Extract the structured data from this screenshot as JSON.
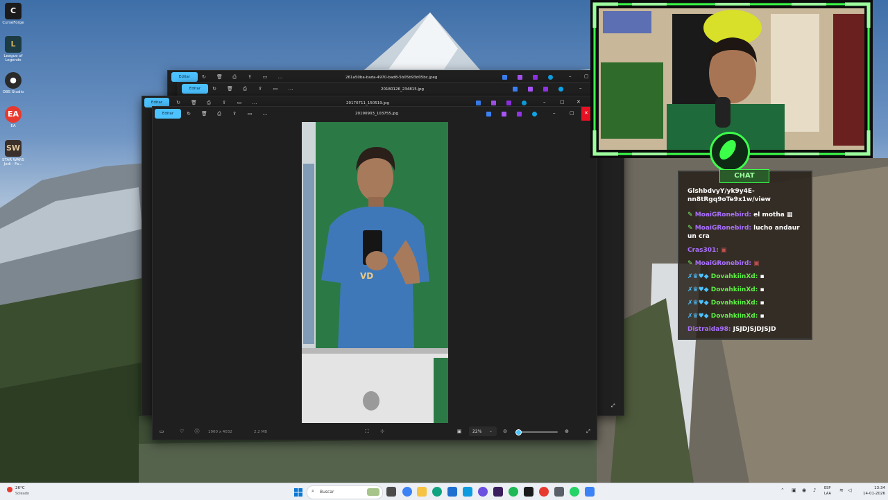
{
  "desktop": {
    "icons": [
      {
        "label": "CurseForge",
        "icon": "curseforge-icon",
        "color": "#1b1b1b"
      },
      {
        "label": "League of Legends",
        "icon": "league-of-legends-icon",
        "color": "#1c3b42"
      },
      {
        "label": "OBS Studio",
        "icon": "obs-icon",
        "color": "#2a2a2a"
      },
      {
        "label": "EA",
        "icon": "ea-icon",
        "color": "#e8392f"
      },
      {
        "label": "STAR WARS Jedi - Fa...",
        "icon": "star-wars-icon",
        "color": "#3a2f2a"
      }
    ]
  },
  "windows": [
    {
      "filename": "261a50ba-bada-4970-bad8-5b05b93d05bc.jpeg",
      "edit_label": "Editar"
    },
    {
      "filename": "20180126_234815.jpg",
      "edit_label": "Editar"
    },
    {
      "filename": "20170711_150519.jpg",
      "edit_label": "Editar"
    },
    {
      "filename": "20190903_103755.jpg",
      "edit_label": "Editar"
    }
  ],
  "viewer": {
    "resolution": "1960 x 4032",
    "size": "2.2 MB",
    "zoom": "22%",
    "zoom_slider_fraction": 0.05
  },
  "chat": {
    "header": "CHAT",
    "lines": [
      {
        "user": "",
        "text": "GlshbdvyY/yk9y4E-nn8tRgq9oTe9x1w/view",
        "user_color": "#ffffff"
      },
      {
        "user": "MoaiGRonebird:",
        "text": "el motha",
        "user_color": "#a970ff"
      },
      {
        "user": "MoaiGRonebird:",
        "text": "lucho andaur un cra",
        "user_color": "#a970ff"
      },
      {
        "user": "Cras301:",
        "text": "",
        "user_color": "#a970ff"
      },
      {
        "user": "MoaiGRonebird:",
        "text": "",
        "user_color": "#a970ff"
      },
      {
        "user": "DovahkiinXd:",
        "text": "",
        "user_color": "#5ef046"
      },
      {
        "user": "DovahkiinXd:",
        "text": "",
        "user_color": "#5ef046"
      },
      {
        "user": "DovahkiinXd:",
        "text": "",
        "user_color": "#5ef046"
      },
      {
        "user": "DovahkiinXd:",
        "text": "",
        "user_color": "#5ef046"
      },
      {
        "user": "Distraida98:",
        "text": "JSJDJSJDJSJD",
        "user_color": "#a970ff"
      }
    ]
  },
  "taskbar": {
    "weather_temp": "26°C",
    "weather_desc": "Soleado",
    "search_placeholder": "Buscar",
    "lang_top": "ESP",
    "lang_bottom": "LAA",
    "time": "13:34",
    "date": "14-01-2026"
  },
  "colors": {
    "accent": "#4cc2ff",
    "overlay_green": "#3cff4a",
    "window_bg": "#202020"
  }
}
